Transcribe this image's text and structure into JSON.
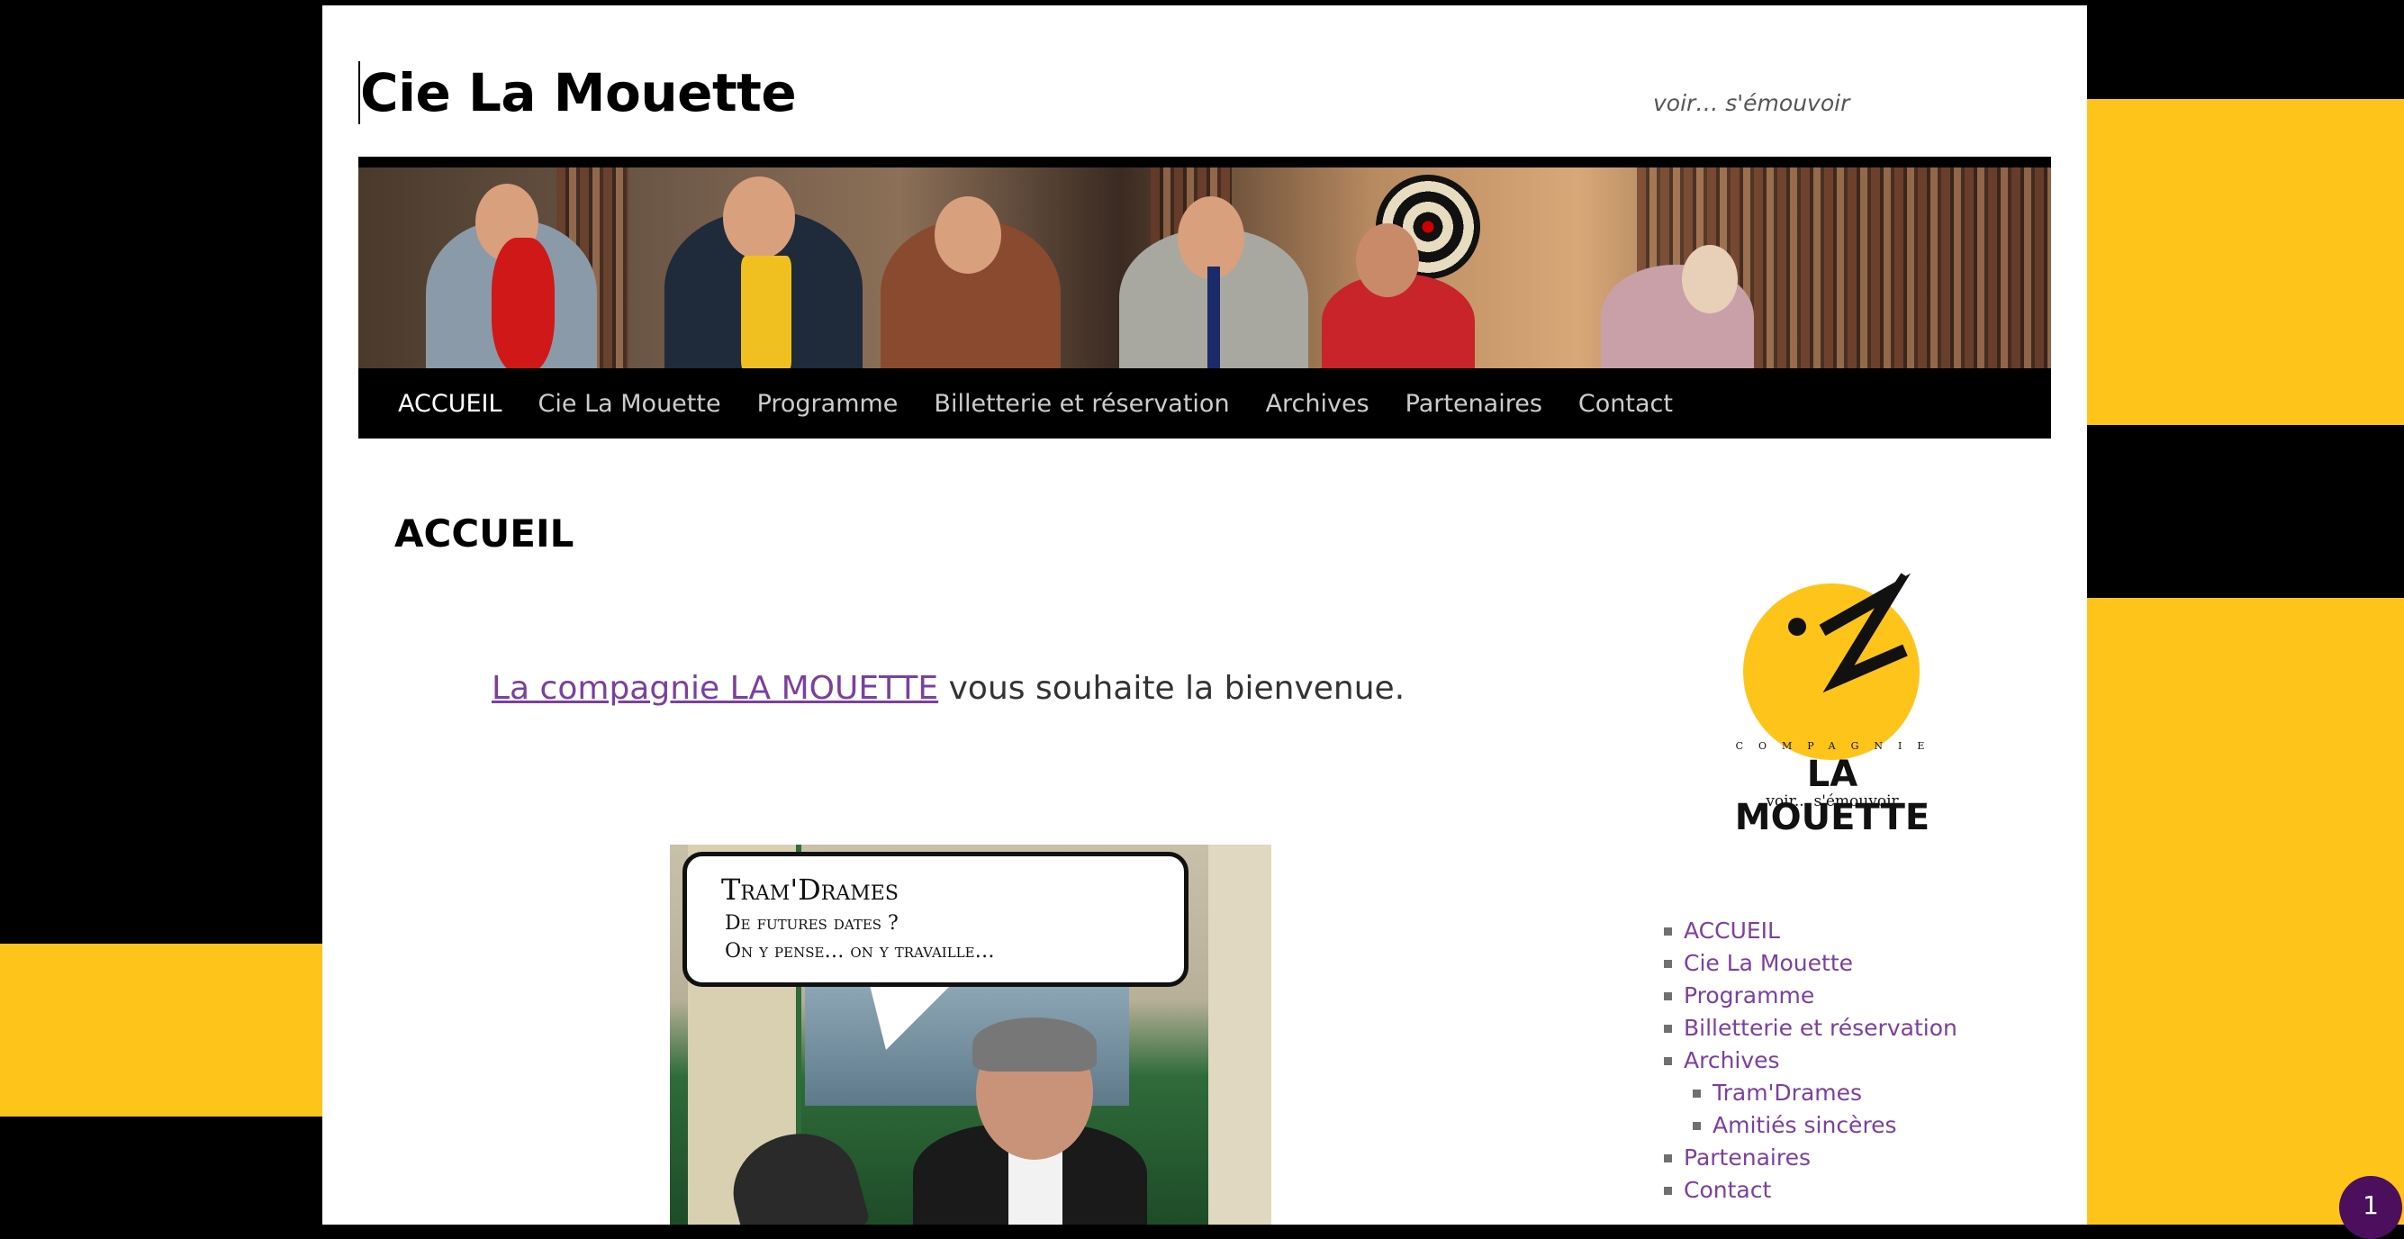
{
  "site": {
    "title": "Cie La Mouette",
    "tagline": "voir… s'émouvoir"
  },
  "nav": {
    "items": [
      "ACCUEIL",
      "Cie La Mouette",
      "Programme",
      "Billetterie et réservation",
      "Archives",
      "Partenaires",
      "Contact"
    ]
  },
  "main": {
    "title": "ACCUEIL",
    "welcome_link": "La compagnie LA MOUETTE",
    "welcome_rest": " vous souhaite la bienvenue.",
    "promo": {
      "heading": "Tram'Drames",
      "line1": "De futures dates ?",
      "line2": "On y pense… on y travaille…"
    }
  },
  "logo": {
    "small": "COMPAGNIE",
    "big": "LA MOUETTE",
    "tag": "voir... s'émouvoir"
  },
  "sidebar": {
    "items": [
      "ACCUEIL",
      "Cie La Mouette",
      "Programme",
      "Billetterie et réservation",
      "Archives",
      "Tram'Drames",
      "Amitiés sincères",
      "Partenaires",
      "Contact"
    ]
  },
  "badge": {
    "count": "1"
  },
  "colors": {
    "accent": "#fec41a",
    "link": "#7b3fa0",
    "nav_bg": "#000000"
  }
}
